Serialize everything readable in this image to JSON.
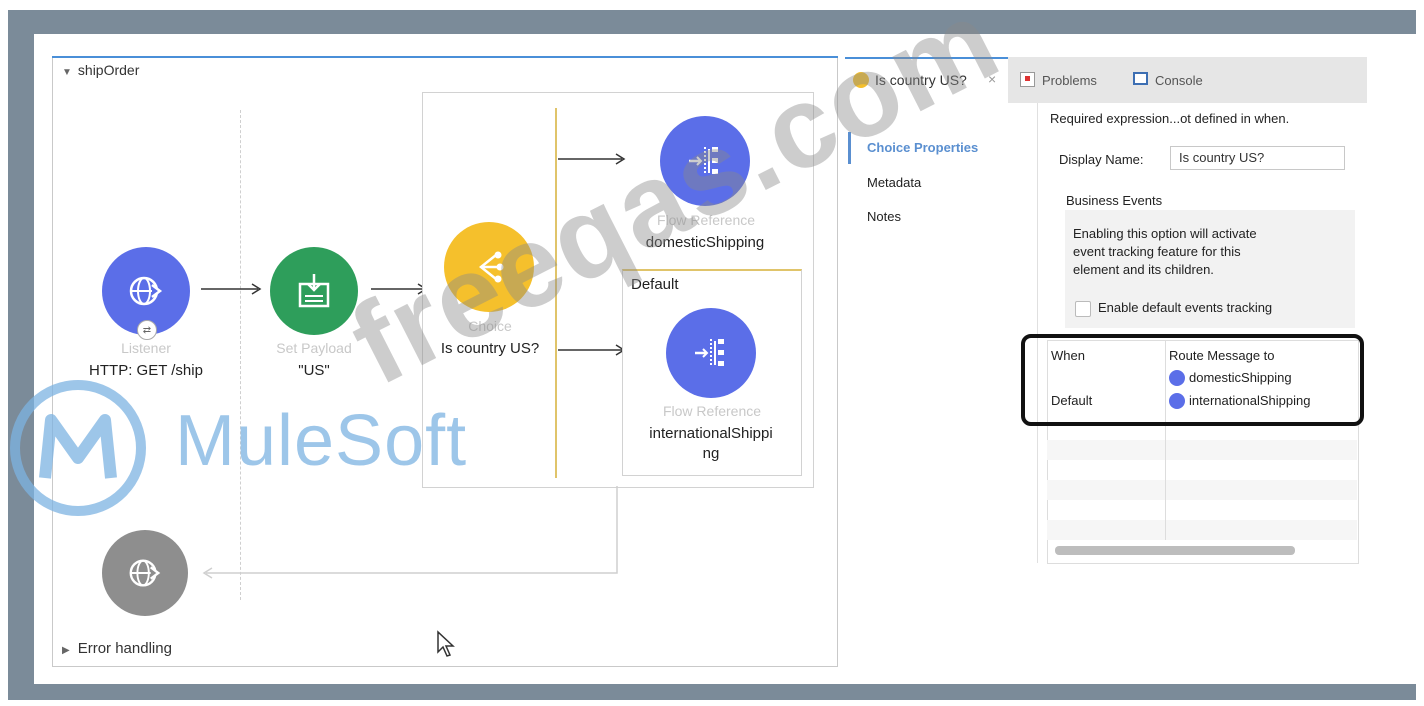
{
  "flow": {
    "name": "shipOrder",
    "error_handling": "Error handling",
    "listener": {
      "type": "Listener",
      "label": "HTTP: GET /ship"
    },
    "set_payload": {
      "type": "Set Payload",
      "label": "\"US\""
    },
    "choice": {
      "type": "Choice",
      "label": "Is country US?"
    },
    "when_ref": {
      "type": "Flow Reference",
      "label": "domesticShipping"
    },
    "default_ref": {
      "type": "Flow Reference",
      "label_line1": "internationalShippi",
      "label_line2": "ng"
    },
    "default_label": "Default"
  },
  "panel": {
    "tabs": [
      {
        "label": "Is country US?",
        "active": true
      },
      {
        "label": "Problems",
        "active": false
      },
      {
        "label": "Console",
        "active": false
      }
    ],
    "side_nav": [
      "Choice Properties",
      "Metadata",
      "Notes"
    ],
    "warning": "Required expression...ot defined in when.",
    "display_name_label": "Display Name:",
    "display_name_value": "Is country US?",
    "business_events_title": "Business Events",
    "business_events_desc_1": "Enabling this option will activate",
    "business_events_desc_2": "event tracking feature for this",
    "business_events_desc_3": "element and its children.",
    "enable_tracking_label": "Enable default events tracking",
    "enable_tracking_checked": false,
    "table": {
      "headers": [
        "When",
        "Route Message to"
      ],
      "rows": [
        {
          "when": "",
          "route": "domesticShipping"
        },
        {
          "when": "Default",
          "route": "internationalShipping"
        }
      ]
    }
  },
  "watermarks": {
    "brand": "MuleSoft",
    "site": "freeqas.com"
  },
  "colors": {
    "frame": "#7b8b99",
    "listener": "#5b6ee8",
    "set_payload": "#2e9e5b",
    "choice": "#f5c02c",
    "flow_reference": "#5b6ee8",
    "error_source": "#8e8e8e",
    "accent": "#4a8fd8"
  }
}
